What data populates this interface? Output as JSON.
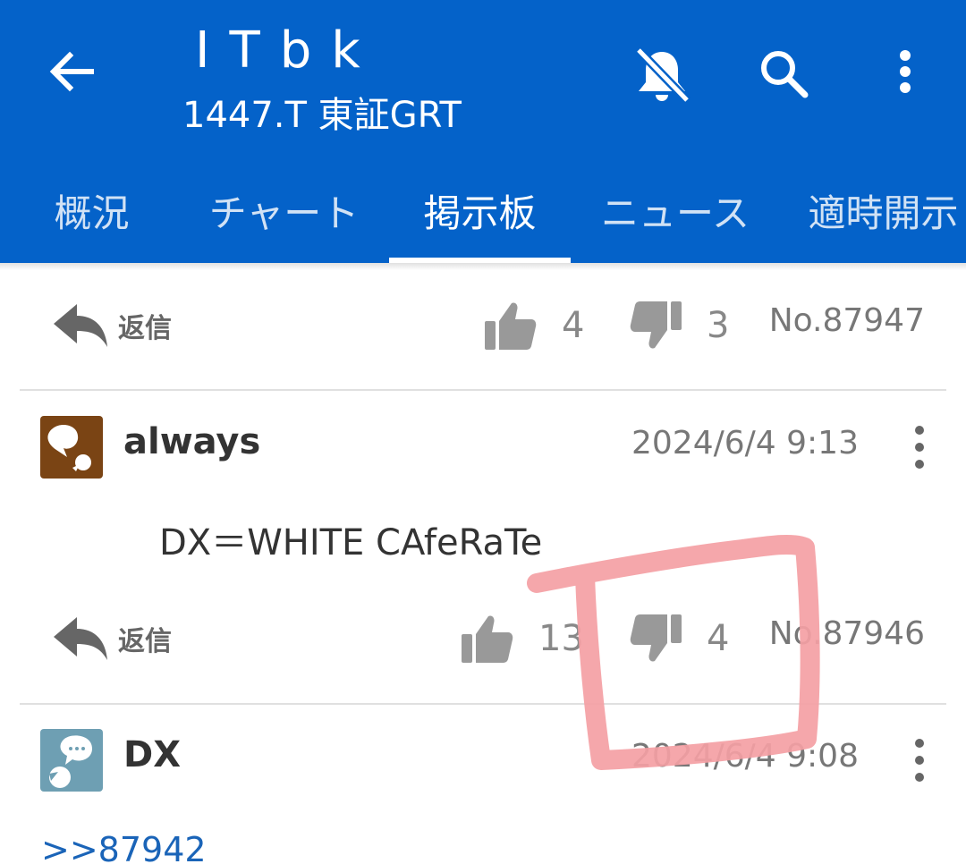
{
  "header": {
    "title": "ITbk",
    "subtitle": "1447.T 東証GRT"
  },
  "tabs": [
    {
      "label": "概況"
    },
    {
      "label": "チャート"
    },
    {
      "label": "掲示板"
    },
    {
      "label": "ニュース"
    },
    {
      "label": "適時開示"
    }
  ],
  "active_tab": "掲示板",
  "reply_label": "返信",
  "posts": [
    {
      "likes": "4",
      "dislikes": "3",
      "number": "No.87947"
    },
    {
      "author": "always",
      "timestamp": "2024/6/4 9:13",
      "body": "DX＝WHITE CAfeRaTe",
      "likes": "13",
      "dislikes": "4",
      "number": "No.87946"
    },
    {
      "author": "DX",
      "timestamp": "2024/6/4 9:08",
      "body_link": ">>87942"
    }
  ],
  "colors": {
    "appbar": "#0462c9",
    "annotation": "#f4a0a4",
    "avatar_always": "#7a4414",
    "avatar_dx": "#6e9fb3"
  },
  "icons": [
    "back-arrow-icon",
    "bell-off-icon",
    "search-icon",
    "more-vert-icon",
    "reply-icon",
    "thumbs-up-icon",
    "thumbs-down-icon"
  ]
}
